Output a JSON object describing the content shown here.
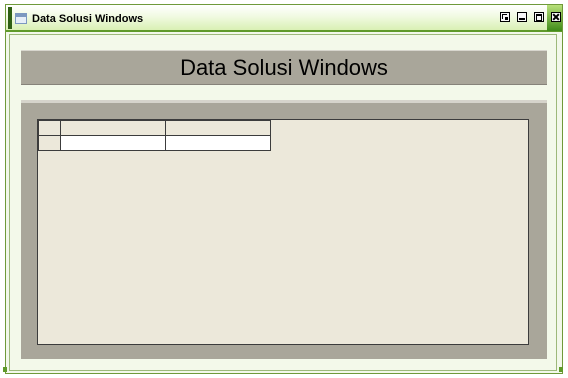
{
  "window": {
    "title": "Data Solusi Windows",
    "title_icon": "window-app-icon",
    "controls": {
      "resize_icon": "resize-icon",
      "minimize_icon": "minimize-icon",
      "maximize_icon": "maximize-icon",
      "close_icon": "close-icon"
    },
    "accent_color": "#5f9a2a",
    "frame_color": "#f2f8ea"
  },
  "form": {
    "heading": "Data Solusi Windows",
    "banner_color": "#a9a69a"
  },
  "grid": {
    "columns": [
      "",
      ""
    ],
    "rows": [
      [
        "",
        ""
      ]
    ]
  }
}
